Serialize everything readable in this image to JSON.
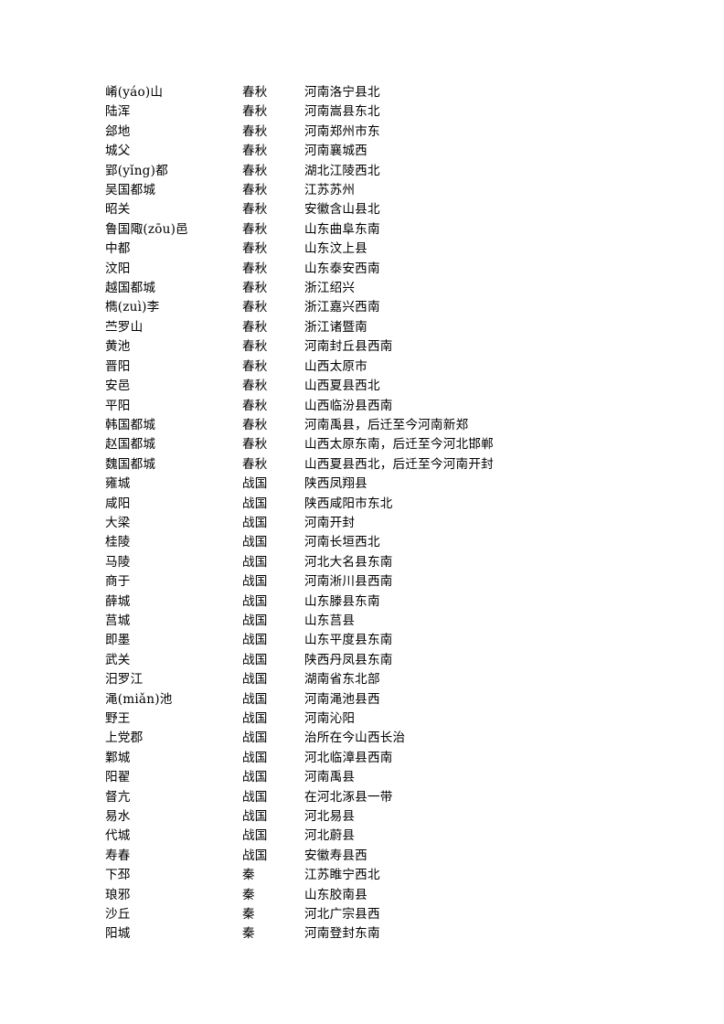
{
  "document": {
    "columns": [
      "place_name",
      "period",
      "modern_location"
    ],
    "rows": [
      {
        "name": "崤(yáo)山",
        "period": "春秋",
        "location": "河南洛宁县北"
      },
      {
        "name": "陆浑",
        "period": "春秋",
        "location": "河南嵩县东北"
      },
      {
        "name": "郐地",
        "period": "春秋",
        "location": "河南郑州市东"
      },
      {
        "name": "城父",
        "period": "春秋",
        "location": "河南襄城西"
      },
      {
        "name": "郢(yǐng)都",
        "period": "春秋",
        "location": "湖北江陵西北"
      },
      {
        "name": "吴国都城",
        "period": "春秋",
        "location": "江苏苏州"
      },
      {
        "name": "昭关",
        "period": "春秋",
        "location": "安徽含山县北"
      },
      {
        "name": "鲁国陬(zōu)邑",
        "period": "春秋",
        "location": "山东曲阜东南"
      },
      {
        "name": "中都",
        "period": "春秋",
        "location": "山东汶上县"
      },
      {
        "name": "汶阳",
        "period": "春秋",
        "location": "山东泰安西南"
      },
      {
        "name": "越国都城",
        "period": "春秋",
        "location": "浙江绍兴"
      },
      {
        "name": "檇(zuì)李",
        "period": "春秋",
        "location": "浙江嘉兴西南"
      },
      {
        "name": "苎罗山",
        "period": "春秋",
        "location": "浙江诸暨南"
      },
      {
        "name": "黄池",
        "period": "春秋",
        "location": "河南封丘县西南"
      },
      {
        "name": "晋阳",
        "period": "春秋",
        "location": "山西太原市"
      },
      {
        "name": "安邑",
        "period": "春秋",
        "location": "山西夏县西北"
      },
      {
        "name": "平阳",
        "period": "春秋",
        "location": "山西临汾县西南"
      },
      {
        "name": "韩国都城",
        "period": "春秋",
        "location": "河南禹县，后迁至今河南新郑"
      },
      {
        "name": "赵国都城",
        "period": "春秋",
        "location": "山西太原东南，后迁至今河北邯郸"
      },
      {
        "name": "魏国都城",
        "period": "春秋",
        "location": "山西夏县西北，后迁至今河南开封"
      },
      {
        "name": "雍城",
        "period": "战国",
        "location": "陕西凤翔县"
      },
      {
        "name": "咸阳",
        "period": "战国",
        "location": "陕西咸阳市东北"
      },
      {
        "name": "大梁",
        "period": "战国",
        "location": "河南开封"
      },
      {
        "name": "桂陵",
        "period": "战国",
        "location": "河南长垣西北"
      },
      {
        "name": "马陵",
        "period": "战国",
        "location": "河北大名县东南"
      },
      {
        "name": "商于",
        "period": "战国",
        "location": "河南淅川县西南"
      },
      {
        "name": "薛城",
        "period": "战国",
        "location": "山东滕县东南"
      },
      {
        "name": "莒城",
        "period": "战国",
        "location": "山东莒县"
      },
      {
        "name": "即墨",
        "period": "战国",
        "location": "山东平度县东南"
      },
      {
        "name": "武关",
        "period": "战国",
        "location": "陕西丹凤县东南"
      },
      {
        "name": "汨罗江",
        "period": "战国",
        "location": "湖南省东北部"
      },
      {
        "name": "渑(miǎn)池",
        "period": "战国",
        "location": "河南渑池县西"
      },
      {
        "name": "野王",
        "period": "战国",
        "location": "河南沁阳"
      },
      {
        "name": "上党郡",
        "period": "战国",
        "location": "治所在今山西长治"
      },
      {
        "name": "鄴城",
        "period": "战国",
        "location": "河北临漳县西南"
      },
      {
        "name": "阳翟",
        "period": "战国",
        "location": "河南禹县"
      },
      {
        "name": "督亢",
        "period": "战国",
        "location": "在河北涿县一带"
      },
      {
        "name": "易水",
        "period": "战国",
        "location": "河北易县"
      },
      {
        "name": "代城",
        "period": "战国",
        "location": "河北蔚县"
      },
      {
        "name": "寿春",
        "period": "战国",
        "location": "安徽寿县西"
      },
      {
        "name": "下邳",
        "period": "秦",
        "location": "江苏睢宁西北"
      },
      {
        "name": "琅邪",
        "period": "秦",
        "location": "山东胶南县"
      },
      {
        "name": "沙丘",
        "period": "秦",
        "location": "河北广宗县西"
      },
      {
        "name": "阳城",
        "period": "秦",
        "location": "河南登封东南"
      }
    ]
  }
}
